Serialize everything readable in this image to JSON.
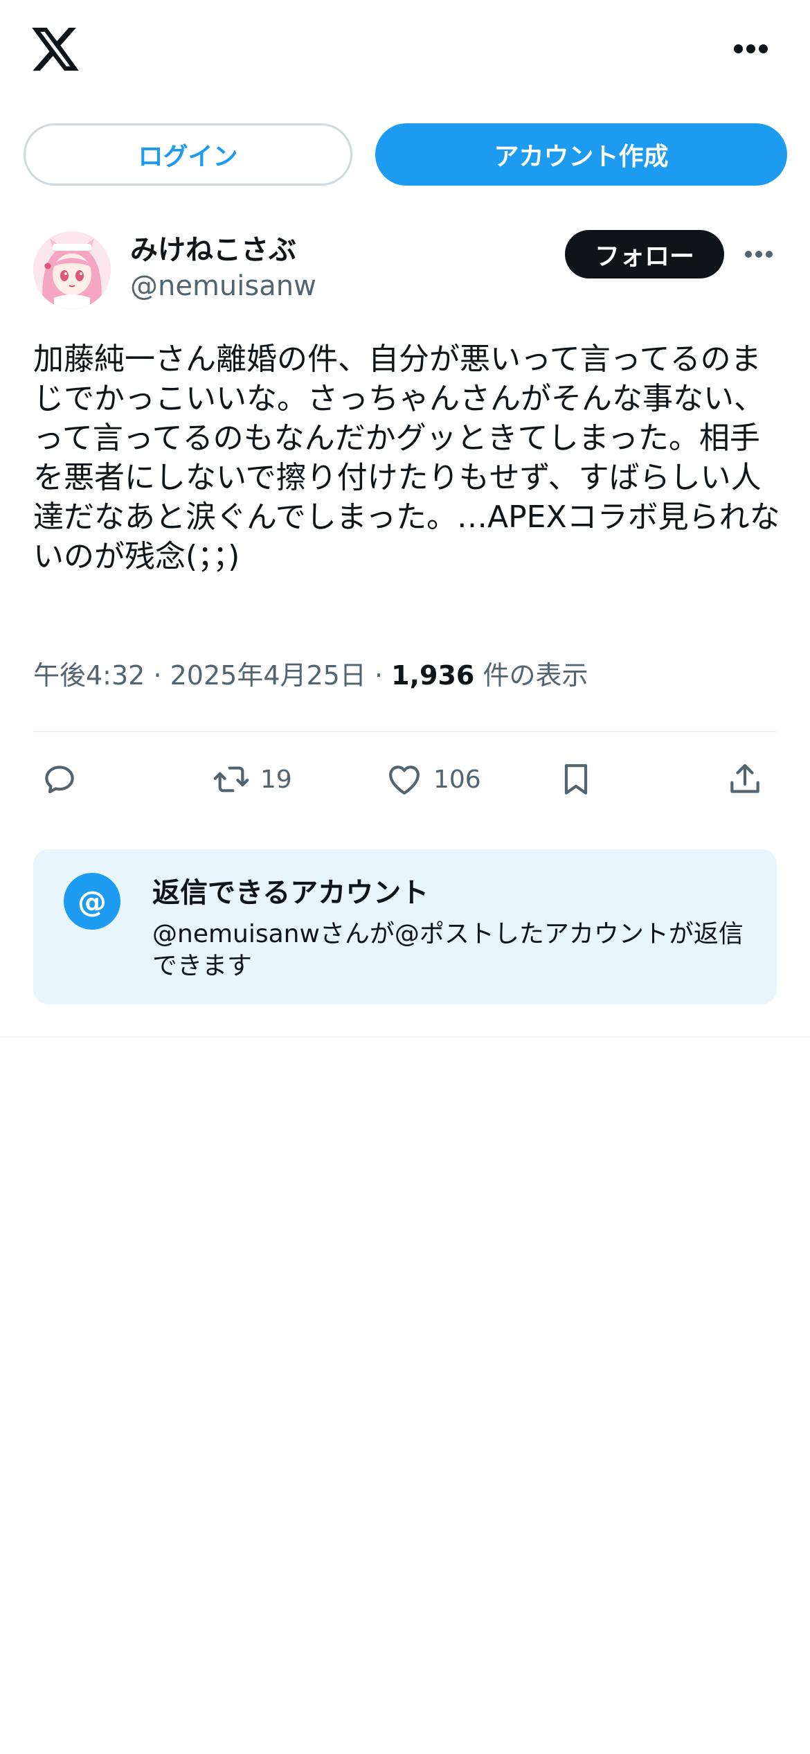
{
  "header": {
    "logo_icon": "x-logo-icon",
    "more_icon": "more-horizontal-icon"
  },
  "auth": {
    "login_label": "ログイン",
    "signup_label": "アカウント作成"
  },
  "tweet": {
    "display_name": "みけねこさぶ",
    "handle": "@nemuisanw",
    "follow_label": "フォロー",
    "text": "加藤純一さん離婚の件、自分が悪いって言ってるのまじでかっこいいな。さっちゃんさんがそんな事ない、って言ってるのもなんだかグッときてしまった。相手を悪者にしないで擦り付けたりもせず、すばらしい人達だなあと涙ぐんでしまった。…APEXコラボ見られないのが残念(；；)",
    "time": "午後4:32",
    "separator": "·",
    "date": "2025年4月25日",
    "views_count": "1,936",
    "views_label": "件の表示"
  },
  "actions": {
    "reply_icon": "reply-icon",
    "retweet_icon": "retweet-icon",
    "retweet_count": "19",
    "like_icon": "heart-icon",
    "like_count": "106",
    "bookmark_icon": "bookmark-icon",
    "share_icon": "share-icon"
  },
  "reply_restriction": {
    "icon": "at-icon",
    "icon_glyph": "@",
    "title": "返信できるアカウント",
    "description": "@nemuisanwさんが@ポストしたアカウントが返信できます"
  },
  "colors": {
    "accent": "#1d9bf0",
    "text_primary": "#0f1419",
    "text_secondary": "#536471",
    "border": "#cfd9de",
    "reply_box_bg": "#e8f5fd"
  }
}
